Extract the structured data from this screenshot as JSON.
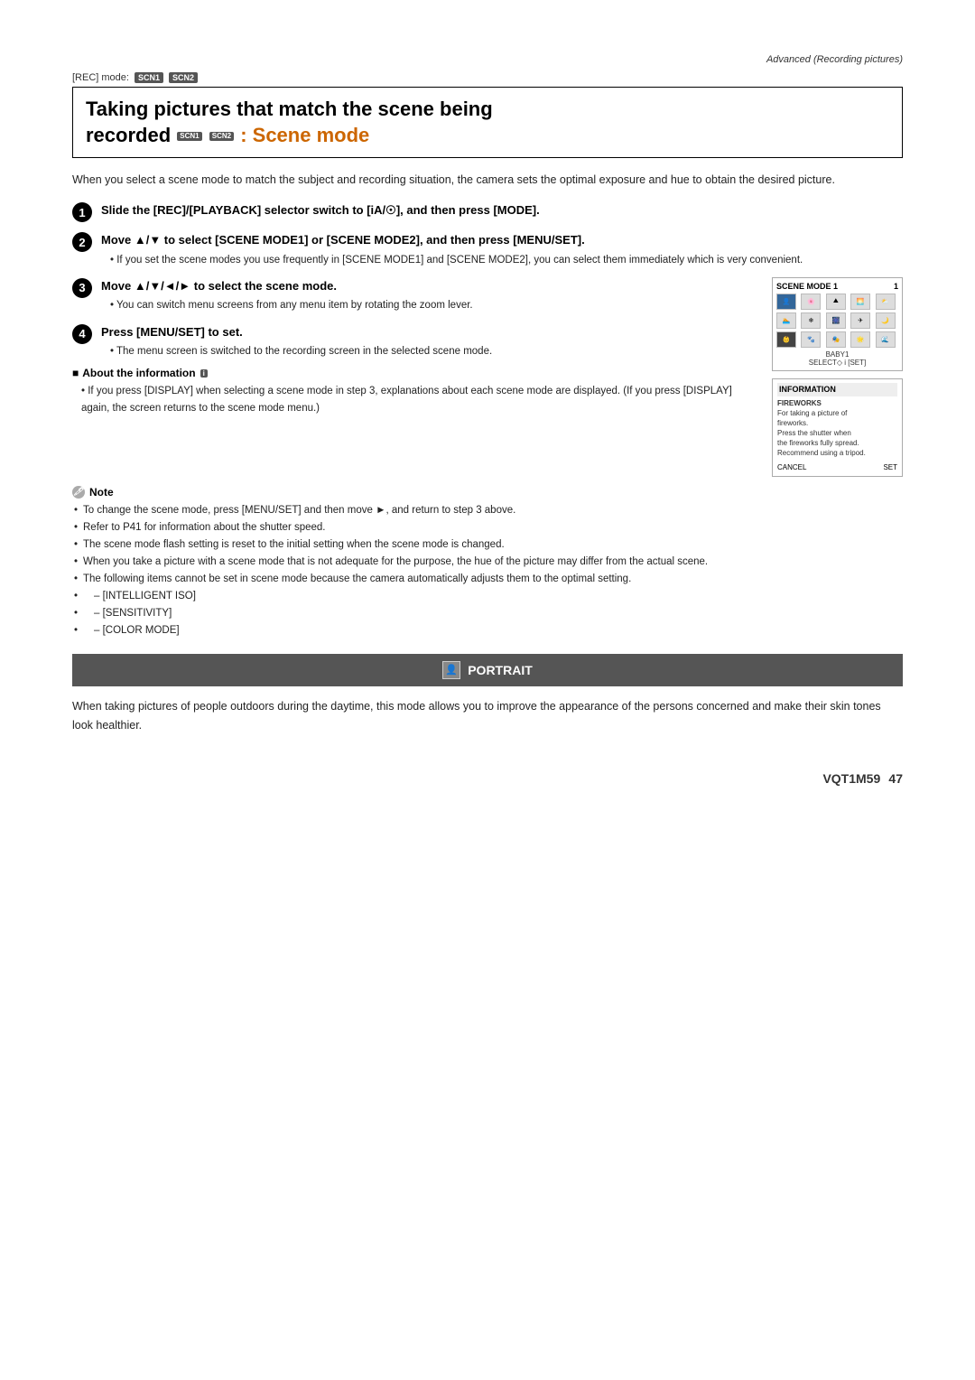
{
  "page": {
    "header": "Advanced (Recording pictures)",
    "footer_code": "VQT1M59",
    "footer_page": "47"
  },
  "rec_mode": {
    "label": "[REC] mode:",
    "badges": [
      "SCN1",
      "SCN2"
    ]
  },
  "title": {
    "line1": "Taking pictures that match the scene being",
    "line2_plain": "recorded ",
    "line2_orange": ": Scene mode"
  },
  "intro": "When you select a scene mode to match the subject and recording situation, the camera sets the optimal exposure and hue to obtain the desired picture.",
  "steps": [
    {
      "number": "1",
      "text": "Slide the [REC]/[PLAYBACK] selector switch to [iA/☉], and then press [MODE]."
    },
    {
      "number": "2",
      "text": "Move ▲/▼ to select [SCENE MODE1] or [SCENE MODE2], and then press [MENU/SET].",
      "sub_note": "If you set the scene modes you use frequently in [SCENE MODE1] and [SCENE MODE2], you can select them immediately which is very convenient."
    },
    {
      "number": "3",
      "text": "Move ▲/▼/◄/► to select the scene mode.",
      "sub_note": "You can switch menu screens from any menu item by rotating the zoom lever."
    },
    {
      "number": "4",
      "text": "Press [MENU/SET] to set.",
      "sub_note": "The menu screen is switched to the recording screen in the selected scene mode."
    }
  ],
  "scene_mode_box": {
    "header_left": "SCENE MODE 1",
    "header_right": "1",
    "footer_label": "BABY1",
    "footer_nav": "SELECT◇ i [SET]",
    "grid_rows": 3,
    "grid_cols": 5
  },
  "about_info": {
    "title": "About the information",
    "icon": "i",
    "text": "If you press [DISPLAY] when selecting a scene mode in step 3, explanations about each scene mode are displayed. (If you press [DISPLAY] again, the screen returns to the scene mode menu.)"
  },
  "info_box": {
    "title": "INFORMATION",
    "item": "FIREWORKS",
    "lines": [
      "For taking a picture of",
      "fireworks.",
      "Press the shutter when",
      "the fireworks fully spread.",
      "Recommend using a tripod."
    ],
    "footer_left": "CANCEL",
    "footer_right": "SET"
  },
  "notes": {
    "title": "Note",
    "items": [
      "To change the scene mode, press [MENU/SET] and then move ►, and return to step 3 above.",
      "Refer to P41 for information about the shutter speed.",
      "The scene mode flash setting is reset to the initial setting when the scene mode is changed.",
      "When you take a picture with a scene mode that is not adequate for the purpose, the hue of the picture may differ from the actual scene.",
      "The following items cannot be set in scene mode because the camera automatically adjusts them to the optimal setting.",
      "– [INTELLIGENT ISO]",
      "– [SENSITIVITY]",
      "– [COLOR MODE]"
    ]
  },
  "portrait": {
    "banner_icon": "👤",
    "banner_text": "PORTRAIT",
    "description": "When taking pictures of people outdoors during the daytime, this mode allows you to improve the appearance of the persons concerned and make their skin tones look healthier."
  }
}
